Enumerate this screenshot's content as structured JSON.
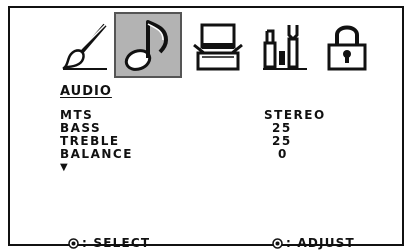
{
  "tabs": [
    {
      "icon": "paintbrush-icon",
      "selected": false
    },
    {
      "icon": "music-note-icon",
      "selected": true
    },
    {
      "icon": "tv-box-icon",
      "selected": false
    },
    {
      "icon": "tools-icon",
      "selected": false
    },
    {
      "icon": "lock-icon",
      "selected": false
    }
  ],
  "section_title": "AUDIO",
  "settings": [
    {
      "label": "MTS",
      "value": "STEREO"
    },
    {
      "label": "BASS",
      "value": "25"
    },
    {
      "label": "TREBLE",
      "value": "25"
    },
    {
      "label": "BALANCE",
      "value": "0"
    }
  ],
  "more_indicator": "▼",
  "footer": {
    "select_label": ": SELECT",
    "adjust_label": ": ADJUST"
  },
  "colors": {
    "selected_tab": "#b3b3b3",
    "border": "#111111"
  }
}
